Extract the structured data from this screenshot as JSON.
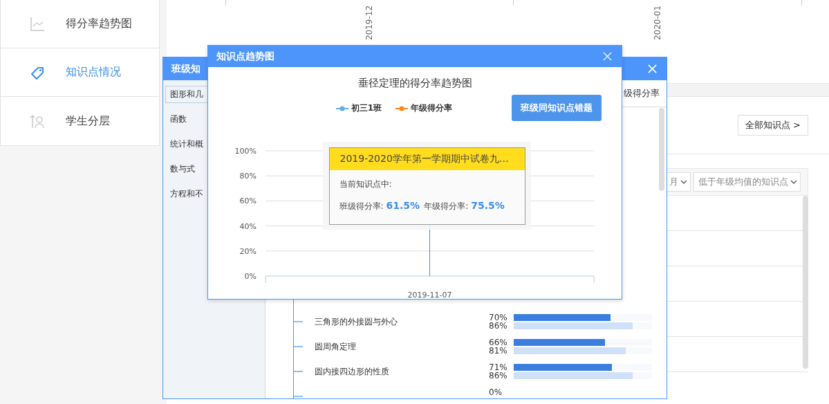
{
  "sidebar": {
    "items": [
      {
        "label": "得分率趋势图",
        "selected": false
      },
      {
        "label": "知识点情况",
        "selected": true
      },
      {
        "label": "学生分层",
        "selected": false
      }
    ]
  },
  "background": {
    "axis_labels": [
      "2019-12",
      "2020-01"
    ],
    "all_points_button": "全部知识点 >",
    "filters": [
      "月",
      "低于年级均值的知识点"
    ]
  },
  "class_dialog": {
    "title": "班级知",
    "categories": [
      {
        "label": "图形和几",
        "selected": true
      },
      {
        "label": "函数",
        "selected": false
      },
      {
        "label": "统计和概",
        "selected": false
      },
      {
        "label": "数与式",
        "selected": false
      },
      {
        "label": "方程和不",
        "selected": false
      }
    ],
    "column_header": "级得分率",
    "rows": [
      {
        "name": "三角形的外接圆与外心",
        "class": {
          "pct": "70%",
          "level": 0.7
        },
        "grade": {
          "pct": "86%",
          "level": 0.86
        }
      },
      {
        "name": "圆周角定理",
        "class": {
          "pct": "66%",
          "level": 0.66
        },
        "grade": {
          "pct": "81%",
          "level": 0.81
        }
      },
      {
        "name": "圆内接四边形的性质",
        "class": {
          "pct": "71%",
          "level": 0.71
        },
        "grade": {
          "pct": "86%",
          "level": 0.86
        }
      },
      {
        "class": {
          "pct": "0%"
        }
      }
    ]
  },
  "trend_dialog": {
    "title": "知识点趋势图",
    "chart_title": "垂径定理的得分率趋势图",
    "button": "班级同知识点错题",
    "legend": [
      {
        "name": "初三1班",
        "color": "#5aaef0"
      },
      {
        "name": "年级得分率",
        "color": "#f5891f"
      }
    ],
    "y_tick_labels": [
      "100%",
      "80%",
      "60%",
      "40%",
      "20%",
      "0%"
    ],
    "x_tick_labels": [
      "2019-11-07"
    ],
    "tooltip": {
      "title": "2019-2020学年第一学期期中试卷九…",
      "subtitle": "当前知识点中:",
      "class_label": "班级得分率:",
      "class_value": "61.5%",
      "grade_label": "年级得分率:",
      "grade_value": "75.5%"
    }
  }
}
